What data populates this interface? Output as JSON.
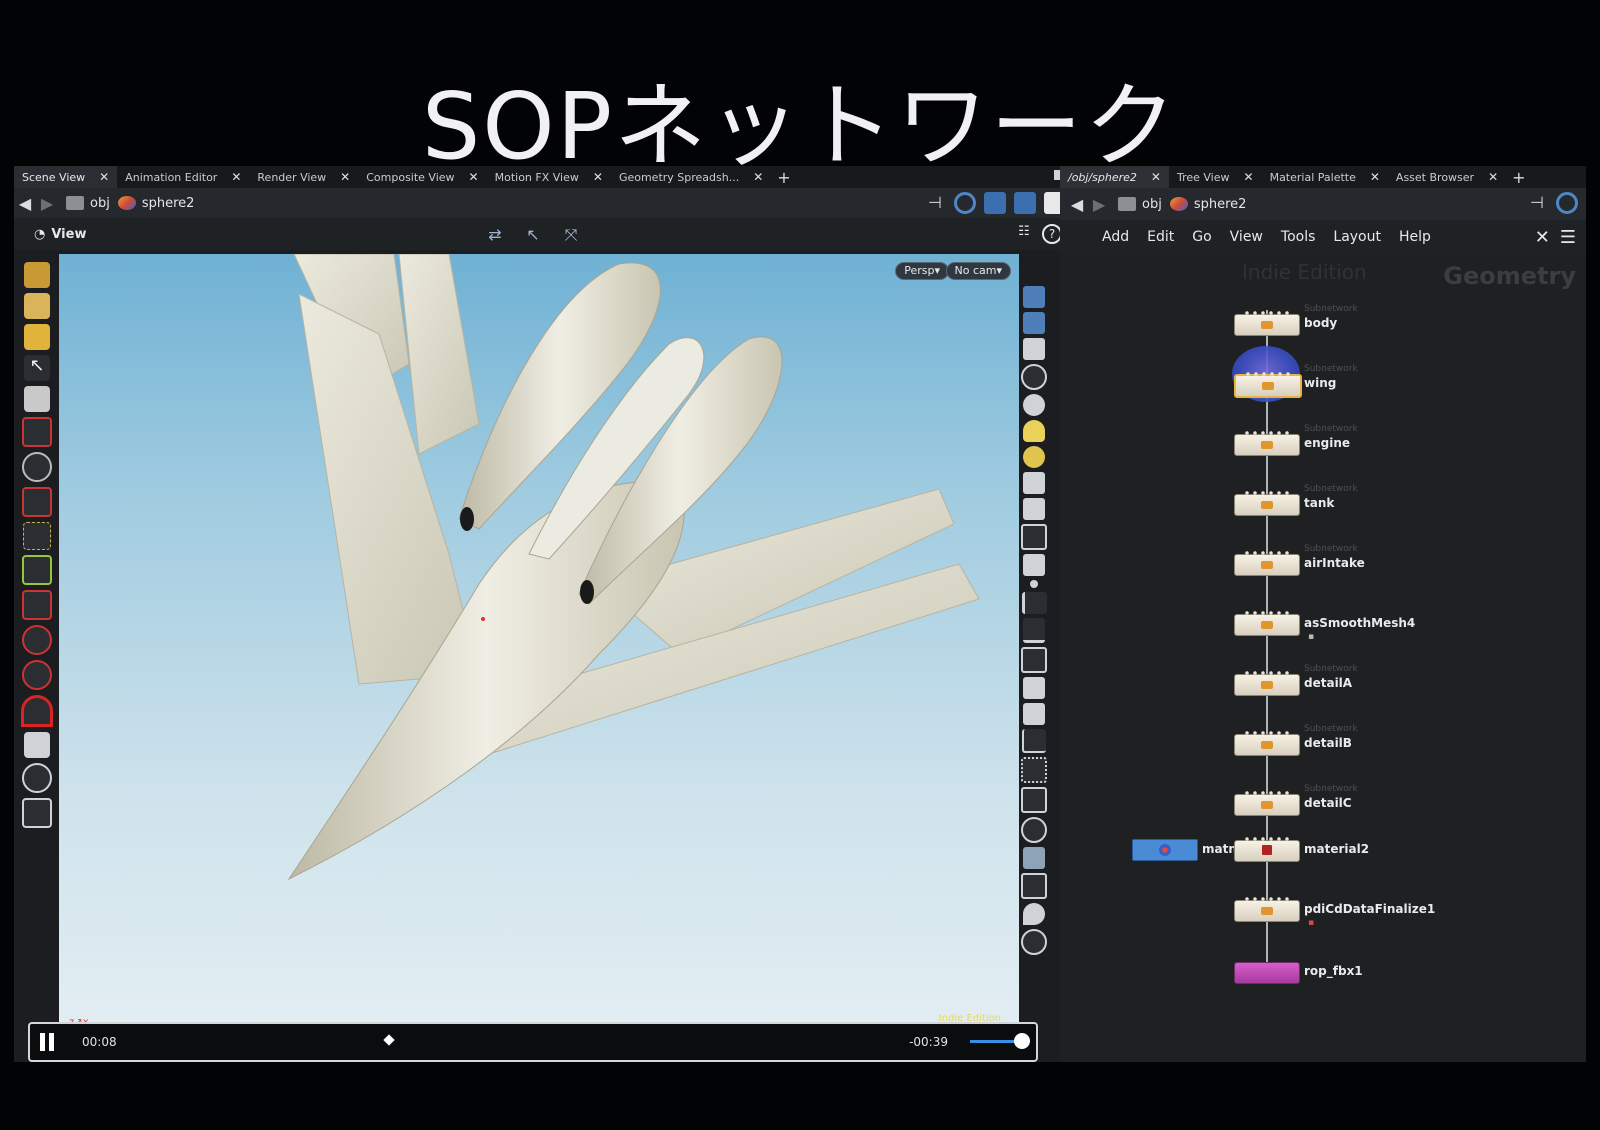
{
  "slide": {
    "title": "SOPネットワーク"
  },
  "left": {
    "tabs": [
      "Scene View",
      "Animation Editor",
      "Render View",
      "Composite View",
      "Motion FX View",
      "Geometry Spreadsh..."
    ],
    "path": {
      "root": "obj",
      "node": "sphere2"
    },
    "view_label": "View",
    "viewport": {
      "persp": "Persp▾",
      "cam": "No cam▾",
      "corner": "Indie Edition"
    }
  },
  "playback": {
    "current": "00:08",
    "remaining": "-00:39"
  },
  "right": {
    "tabs": [
      "/obj/sphere2",
      "Tree View",
      "Material Palette",
      "Asset Browser"
    ],
    "path": {
      "root": "obj",
      "node": "sphere2"
    },
    "menu": [
      "Add",
      "Edit",
      "Go",
      "View",
      "Tools",
      "Layout",
      "Help"
    ],
    "watermark_edition": "Indie Edition",
    "watermark_context": "Geometry",
    "subnetwork_label": "Subnetwork",
    "nodes": [
      {
        "name": "body",
        "subnetwork": true
      },
      {
        "name": "wing",
        "subnetwork": true
      },
      {
        "name": "engine",
        "subnetwork": true
      },
      {
        "name": "tank",
        "subnetwork": true
      },
      {
        "name": "airIntake",
        "subnetwork": true
      },
      {
        "name": "asSmoothMesh4",
        "subnetwork": false
      },
      {
        "name": "detailA",
        "subnetwork": true
      },
      {
        "name": "detailB",
        "subnetwork": true
      },
      {
        "name": "detailC",
        "subnetwork": true
      },
      {
        "name": "material2",
        "subnetwork": false
      },
      {
        "name": "pdiCdDataFinalize1",
        "subnetwork": false
      },
      {
        "name": "rop_fbx1",
        "subnetwork": false
      }
    ],
    "matnet_label": "matn"
  }
}
